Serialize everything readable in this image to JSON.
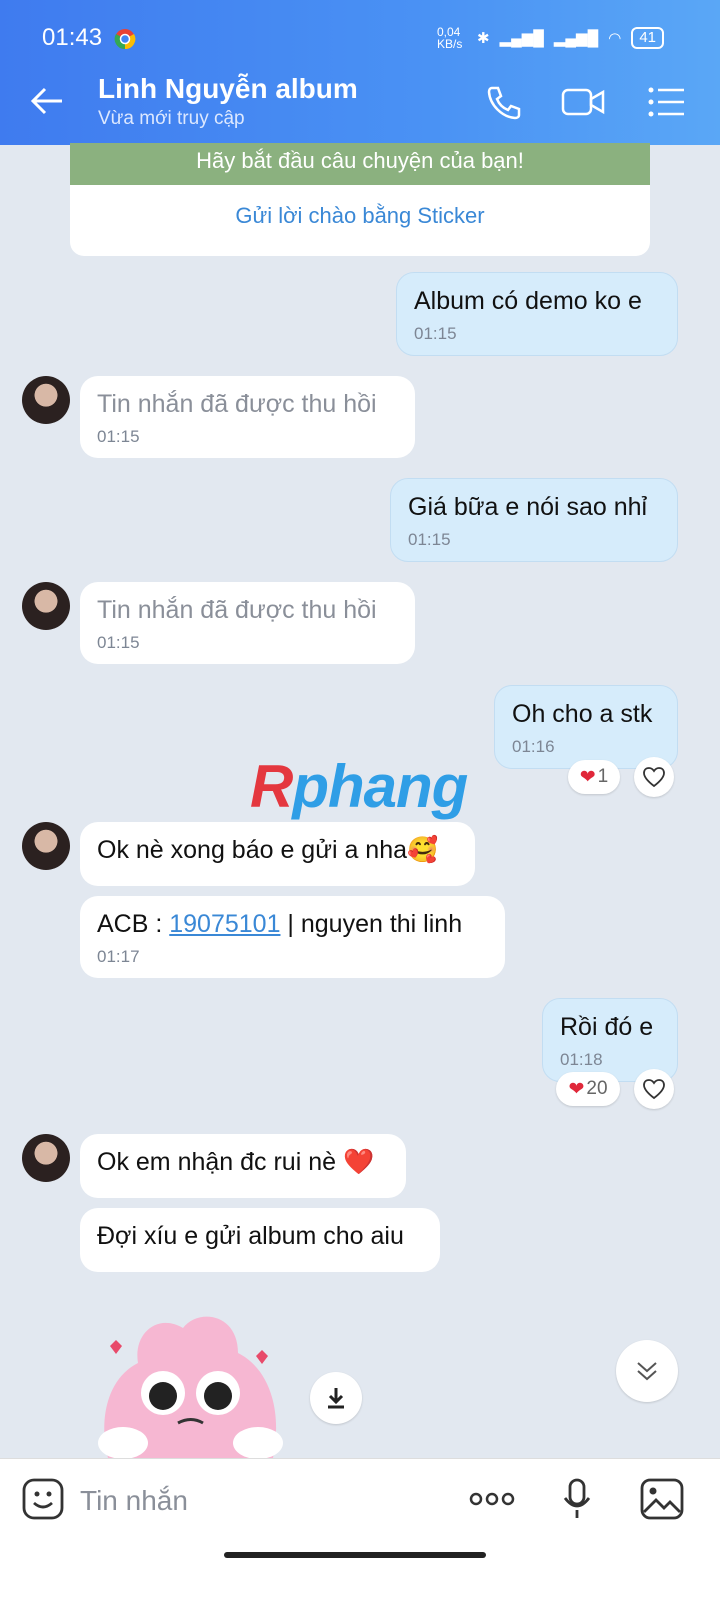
{
  "status_bar": {
    "time": "01:43",
    "net_speed": "0,04 KB/s",
    "battery": "41"
  },
  "header": {
    "title": "Linh Nguyễn album",
    "subtitle": "Vừa mới truy cập"
  },
  "intro": {
    "banner": "Hãy bắt đầu câu chuyện của bạn!",
    "sticker_link": "Gửi lời chào bằng Sticker"
  },
  "messages": [
    {
      "from": "me",
      "text": "Album có demo ko e",
      "time": "01:15"
    },
    {
      "from": "them",
      "text": "Tin nhắn đã được thu hồi",
      "time": "01:15"
    },
    {
      "from": "me",
      "text": "Giá bữa e nói sao nhỉ",
      "time": "01:15"
    },
    {
      "from": "them",
      "text": "Tin nhắn đã được thu hồi",
      "time": "01:15"
    },
    {
      "from": "me",
      "text": "Oh cho a stk",
      "time": "01:16",
      "reaction_count": "1"
    },
    {
      "from": "them",
      "text": "Ok nè xong báo e gửi a nha🥰"
    },
    {
      "from": "them",
      "prefix": "ACB : ",
      "account": "19075101",
      "suffix": " | nguyen thi linh",
      "time": "01:17"
    },
    {
      "from": "me",
      "text": "Rồi đó e",
      "time": "01:18",
      "reaction_count": "20"
    },
    {
      "from": "them",
      "text": "Ok em nhận đc rui nè ❤️"
    },
    {
      "from": "them",
      "text": "Đợi xíu e gửi album cho aiu"
    }
  ],
  "watermark": {
    "first": "R",
    "rest": "phang"
  },
  "composer": {
    "placeholder": "Tin nhắn"
  },
  "colors": {
    "header": "#4a8ff3",
    "bubble_out": "#d6ecfb",
    "bubble_in": "#ffffff",
    "link": "#3a88d6",
    "background": "#e2e8f0"
  }
}
